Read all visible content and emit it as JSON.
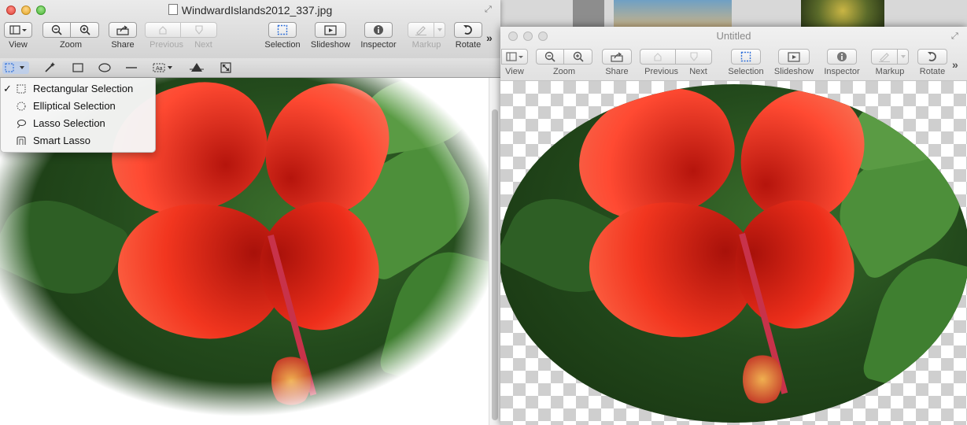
{
  "window_main": {
    "title": "WindwardIslands2012_337.jpg",
    "toolbar": {
      "view_label": "View",
      "zoom_label": "Zoom",
      "share_label": "Share",
      "previous_label": "Previous",
      "next_label": "Next",
      "selection_label": "Selection",
      "slideshow_label": "Slideshow",
      "inspector_label": "Inspector",
      "markup_label": "Markup",
      "rotate_label": "Rotate"
    },
    "overflow_glyph": "»"
  },
  "selection_menu": {
    "items": [
      {
        "label": "Rectangular Selection",
        "checked": true,
        "icon": "rect-selection-icon"
      },
      {
        "label": "Elliptical Selection",
        "checked": false,
        "icon": "ellipse-selection-icon"
      },
      {
        "label": "Lasso Selection",
        "checked": false,
        "icon": "lasso-icon"
      },
      {
        "label": "Smart Lasso",
        "checked": false,
        "icon": "smart-lasso-icon"
      }
    ],
    "check_glyph": "✓"
  },
  "window_untitled": {
    "title": "Untitled",
    "toolbar": {
      "view_label": "View",
      "zoom_label": "Zoom",
      "share_label": "Share",
      "previous_label": "Previous",
      "next_label": "Next",
      "selection_label": "Selection",
      "slideshow_label": "Slideshow",
      "inspector_label": "Inspector",
      "markup_label": "Markup",
      "rotate_label": "Rotate"
    },
    "overflow_glyph": "»"
  },
  "colors": {
    "accent_blue": "#2f6fd8",
    "flower_red": "#e8281c",
    "leaf_green": "#2f6a25"
  }
}
